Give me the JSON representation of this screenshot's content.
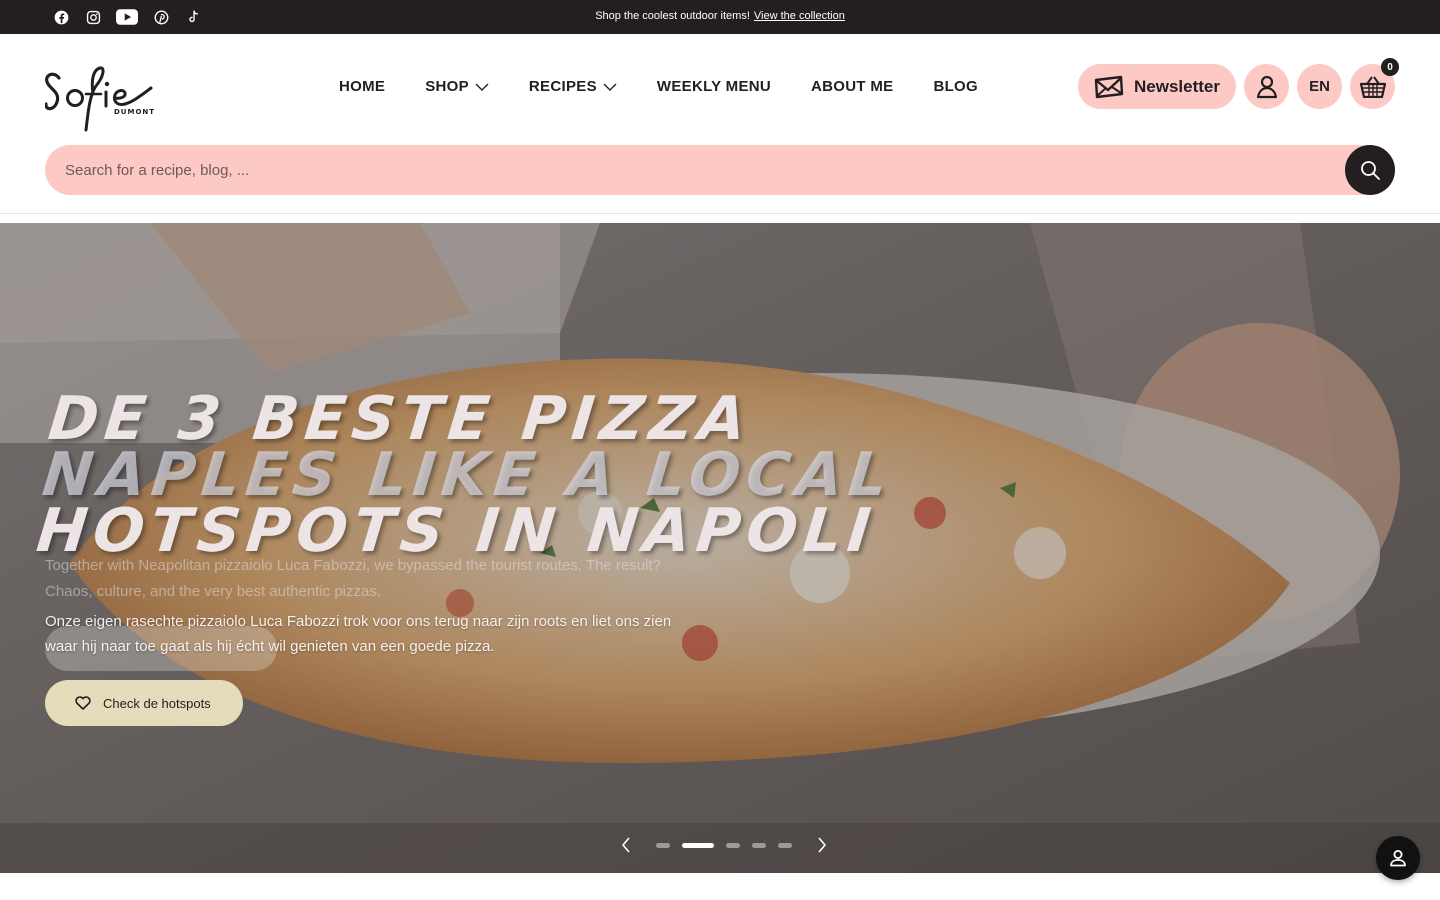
{
  "announcement": {
    "text": "Shop the coolest outdoor items!",
    "link": "View the collection"
  },
  "socials": [
    "facebook-icon",
    "instagram-icon",
    "youtube-icon",
    "pinterest-icon",
    "tiktok-icon"
  ],
  "logo": {
    "name": "Sofie",
    "sub": "DUMONT"
  },
  "nav": {
    "items": [
      {
        "label": "HOME",
        "dropdown": false
      },
      {
        "label": "SHOP",
        "dropdown": true
      },
      {
        "label": "RECIPES",
        "dropdown": true
      },
      {
        "label": "WEEKLY MENU",
        "dropdown": false
      },
      {
        "label": "ABOUT ME",
        "dropdown": false
      },
      {
        "label": "BLOG",
        "dropdown": false
      }
    ]
  },
  "actions": {
    "newsletter": "Newsletter",
    "language": "EN",
    "cart_count": "0"
  },
  "search": {
    "placeholder": "Search for a recipe, blog, ..."
  },
  "hero": {
    "title_line1": "De 3 beste pizza",
    "title_ghost": "Naples like a local",
    "title_line2": "hotspots in Napoli",
    "ghost_text": "Together with Neapolitan pizzaiolo Luca Fabozzi, we bypassed the tourist routes. The result? Chaos, culture, and the very best authentic pizzas.",
    "text": "Onze eigen rasechte pizzaiolo Luca Fabozzi trok voor ons terug naar zijn roots en liet ons zien waar hij naar toe gaat als hij écht wil genieten van een goede pizza.",
    "button": "Check de hotspots",
    "slides": 5,
    "active_slide": 2
  },
  "colors": {
    "accent_pink": "#fdc9c4",
    "dark": "#231f20",
    "hero_button": "#e5dcbc"
  }
}
